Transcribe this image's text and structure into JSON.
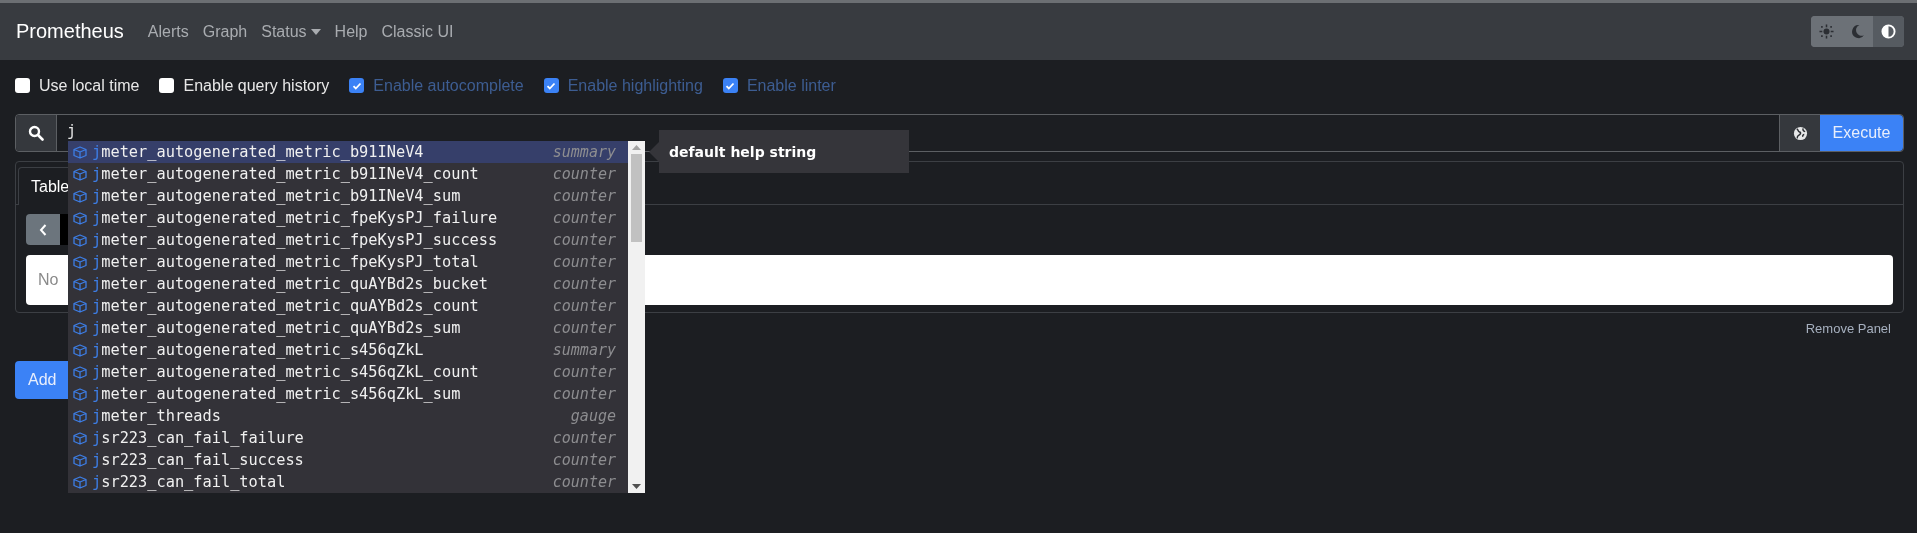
{
  "navbar": {
    "brand": "Prometheus",
    "links": [
      {
        "label": "Alerts",
        "kind": "link"
      },
      {
        "label": "Graph",
        "kind": "link"
      },
      {
        "label": "Status",
        "kind": "dropdown"
      },
      {
        "label": "Help",
        "kind": "link"
      },
      {
        "label": "Classic UI",
        "kind": "link"
      }
    ],
    "theme_toggle": [
      {
        "kind": "light",
        "selected": false
      },
      {
        "kind": "dark",
        "selected": false
      },
      {
        "kind": "auto",
        "selected": true
      }
    ]
  },
  "options": [
    {
      "label": "Use local time",
      "checked": false
    },
    {
      "label": "Enable query history",
      "checked": false
    },
    {
      "label": "Enable autocomplete",
      "checked": true
    },
    {
      "label": "Enable highlighting",
      "checked": true
    },
    {
      "label": "Enable linter",
      "checked": true
    }
  ],
  "expression": {
    "value": "j",
    "execute": "Execute"
  },
  "autocomplete": {
    "help": "default help string",
    "items": [
      {
        "match": "j",
        "rest": "meter_autogenerated_metric_b91INeV4",
        "type": "summary",
        "selected": true
      },
      {
        "match": "j",
        "rest": "meter_autogenerated_metric_b91INeV4_count",
        "type": "counter",
        "selected": false
      },
      {
        "match": "j",
        "rest": "meter_autogenerated_metric_b91INeV4_sum",
        "type": "counter",
        "selected": false
      },
      {
        "match": "j",
        "rest": "meter_autogenerated_metric_fpeKysPJ_failure",
        "type": "counter",
        "selected": false
      },
      {
        "match": "j",
        "rest": "meter_autogenerated_metric_fpeKysPJ_success",
        "type": "counter",
        "selected": false
      },
      {
        "match": "j",
        "rest": "meter_autogenerated_metric_fpeKysPJ_total",
        "type": "counter",
        "selected": false
      },
      {
        "match": "j",
        "rest": "meter_autogenerated_metric_quAYBd2s_bucket",
        "type": "counter",
        "selected": false
      },
      {
        "match": "j",
        "rest": "meter_autogenerated_metric_quAYBd2s_count",
        "type": "counter",
        "selected": false
      },
      {
        "match": "j",
        "rest": "meter_autogenerated_metric_quAYBd2s_sum",
        "type": "counter",
        "selected": false
      },
      {
        "match": "j",
        "rest": "meter_autogenerated_metric_s456qZkL",
        "type": "summary",
        "selected": false
      },
      {
        "match": "j",
        "rest": "meter_autogenerated_metric_s456qZkL_count",
        "type": "counter",
        "selected": false
      },
      {
        "match": "j",
        "rest": "meter_autogenerated_metric_s456qZkL_sum",
        "type": "counter",
        "selected": false
      },
      {
        "match": "j",
        "rest": "meter_threads",
        "type": "gauge",
        "selected": false
      },
      {
        "match": "j",
        "rest": "sr223_can_fail_failure",
        "type": "counter",
        "selected": false
      },
      {
        "match": "j",
        "rest": "sr223_can_fail_success",
        "type": "counter",
        "selected": false
      },
      {
        "match": "j",
        "rest": "sr223_can_fail_total",
        "type": "counter",
        "selected": false
      }
    ]
  },
  "panel": {
    "tabs": [
      {
        "label": "Table",
        "selected": true
      }
    ],
    "message": "No",
    "remove": "Remove Panel"
  },
  "add_panel": "Add"
}
